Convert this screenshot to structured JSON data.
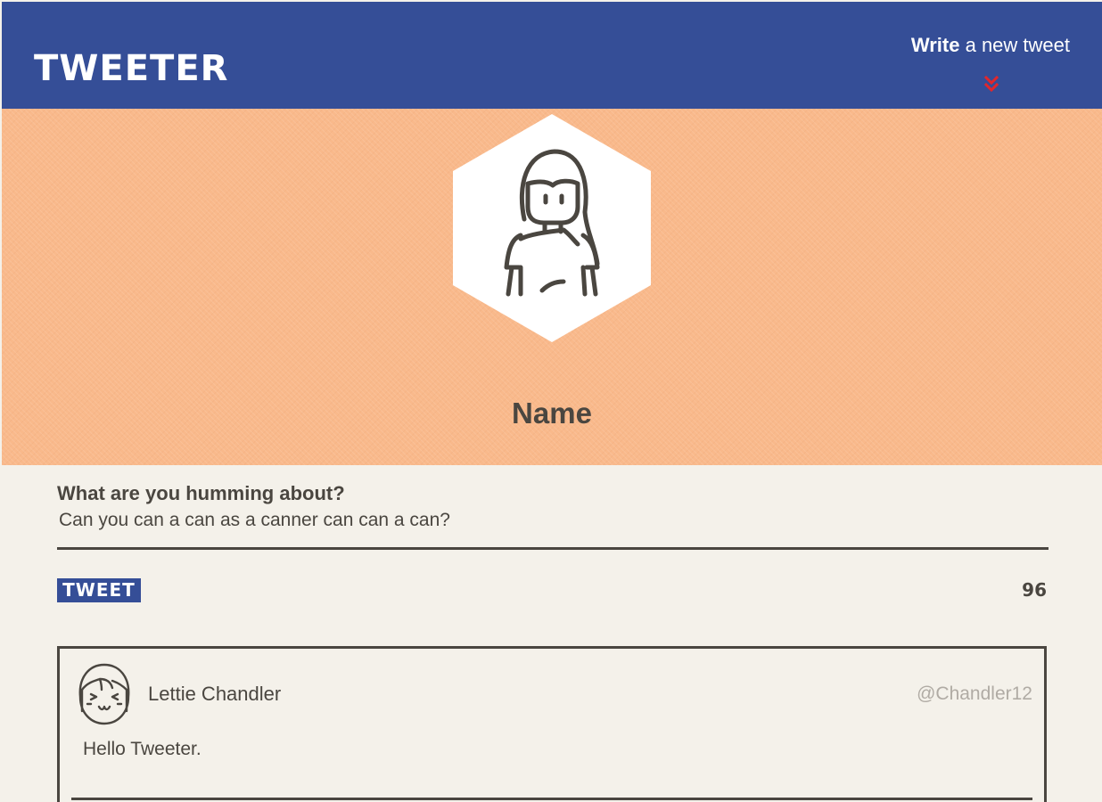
{
  "nav": {
    "brand": "TWEETER",
    "compose_toggle": {
      "strong": "Write",
      "rest": " a new tweet",
      "icon": "double-chevron-down-icon"
    }
  },
  "profile": {
    "avatar_icon": "user-avatar-woman-icon",
    "name": "Name"
  },
  "compose": {
    "label": "What are you humming about?",
    "text": "Can you can a can as a canner can can a can?",
    "button_label": "TWEET",
    "counter": "96"
  },
  "tweets": [
    {
      "avatar_icon": "user-avatar-girl-icon",
      "author": "Lettie Chandler",
      "handle": "@Chandler12",
      "body": "Hello Tweeter."
    }
  ],
  "colors": {
    "nav": "#354e97",
    "banner": "#f9b98b",
    "page": "#f4f1ea",
    "ink": "#4a4640",
    "accent": "#e3262b",
    "muted": "#b0aba4"
  }
}
